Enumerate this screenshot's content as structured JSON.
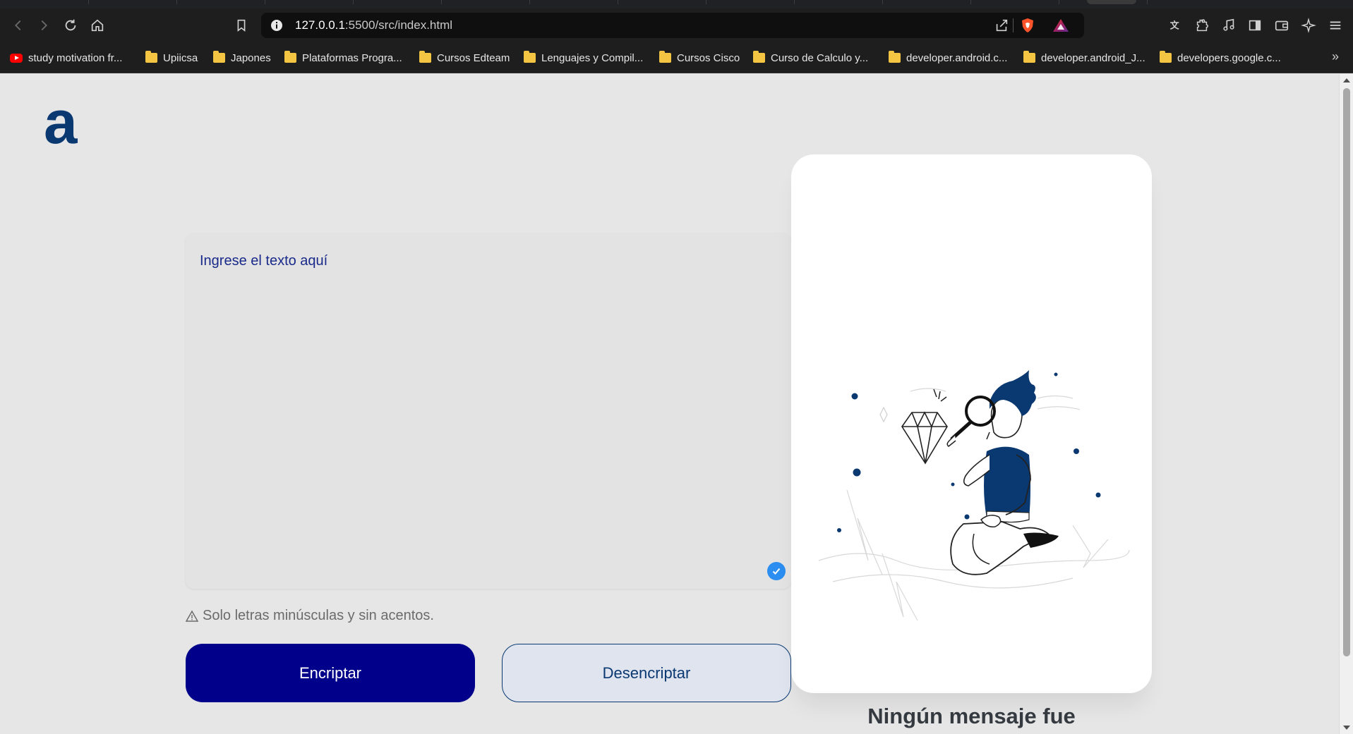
{
  "browser": {
    "url_host": "127.0.0.1",
    "url_path": ":5500/src/index.html",
    "bookmarks": [
      {
        "label": "study motivation fr...",
        "icon": "youtube-icon"
      },
      {
        "label": "Upiicsa",
        "icon": "folder-icon"
      },
      {
        "label": "Japones",
        "icon": "folder-icon"
      },
      {
        "label": "Plataformas Progra...",
        "icon": "folder-icon"
      },
      {
        "label": "Cursos Edteam",
        "icon": "folder-icon"
      },
      {
        "label": "Lenguajes y Compil...",
        "icon": "folder-icon"
      },
      {
        "label": "Cursos Cisco",
        "icon": "folder-icon"
      },
      {
        "label": "Curso de Calculo y...",
        "icon": "folder-icon"
      },
      {
        "label": "developer.android.c...",
        "icon": "folder-icon"
      },
      {
        "label": "developer.android_J...",
        "icon": "folder-icon"
      },
      {
        "label": "developers.google.c...",
        "icon": "folder-icon"
      }
    ],
    "more_bookmarks": "»"
  },
  "app": {
    "logo_letter": "a",
    "input": {
      "placeholder": "Ingrese el texto aquí",
      "value": ""
    },
    "warning": "Solo letras minúsculas y sin acentos.",
    "buttons": {
      "encrypt": "Encriptar",
      "decrypt": "Desencriptar"
    },
    "output": {
      "heading": "Ningún mensaje fue"
    }
  },
  "colors": {
    "primary": "#00008B",
    "accent_text": "#0A3871",
    "page_bg": "#E6E6E6",
    "card_bg": "#FFFFFF",
    "heading": "#343A40"
  }
}
